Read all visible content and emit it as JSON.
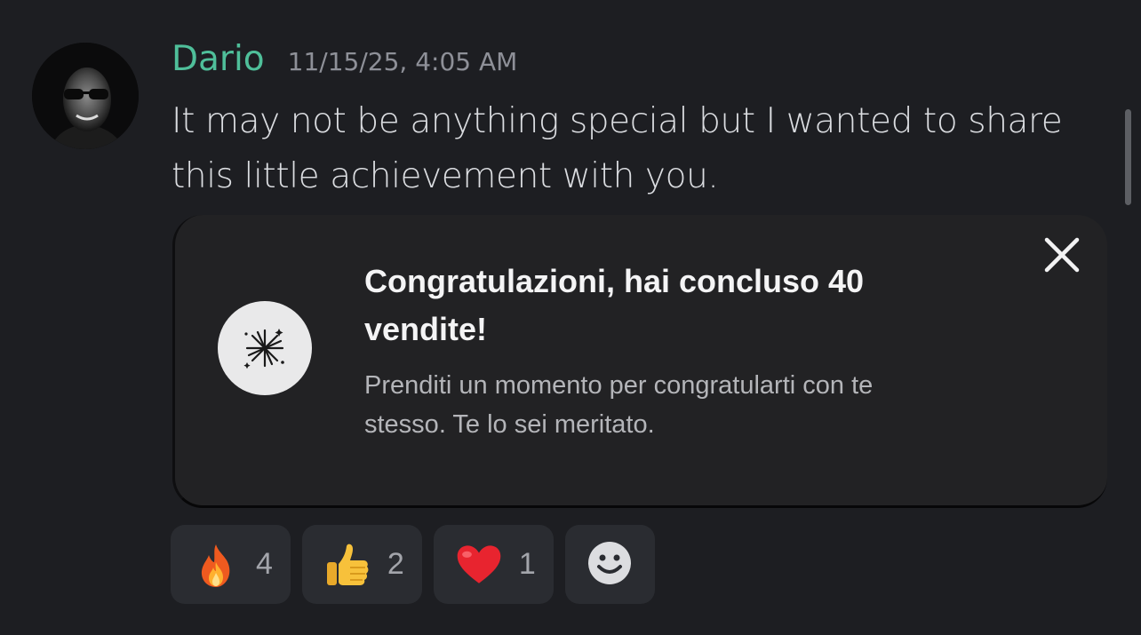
{
  "message": {
    "author": "Dario",
    "timestamp": "11/15/25, 4:05 AM",
    "lines": [
      "It may not be anything special but I wanted to share",
      "this little achievement with you."
    ]
  },
  "embed": {
    "icon": "fireworks-icon",
    "title_lines": [
      "Congratulazioni, hai concluso 40",
      "vendite!"
    ],
    "description_lines": [
      "Prenditi un momento per congratularti con te",
      "stesso. Te lo sei meritato."
    ],
    "close_icon": "close-icon"
  },
  "reactions": [
    {
      "emoji": "fire-emoji",
      "count": "4"
    },
    {
      "emoji": "thumbs-up-emoji",
      "count": "2"
    },
    {
      "emoji": "red-heart-emoji",
      "count": "1"
    }
  ],
  "add_reaction_icon": "smiley-add-reaction-icon",
  "colors": {
    "background": "#1d1e22",
    "username": "#4fbf9a",
    "embed_background": "#222224",
    "reaction_background": "#2a2c31"
  }
}
